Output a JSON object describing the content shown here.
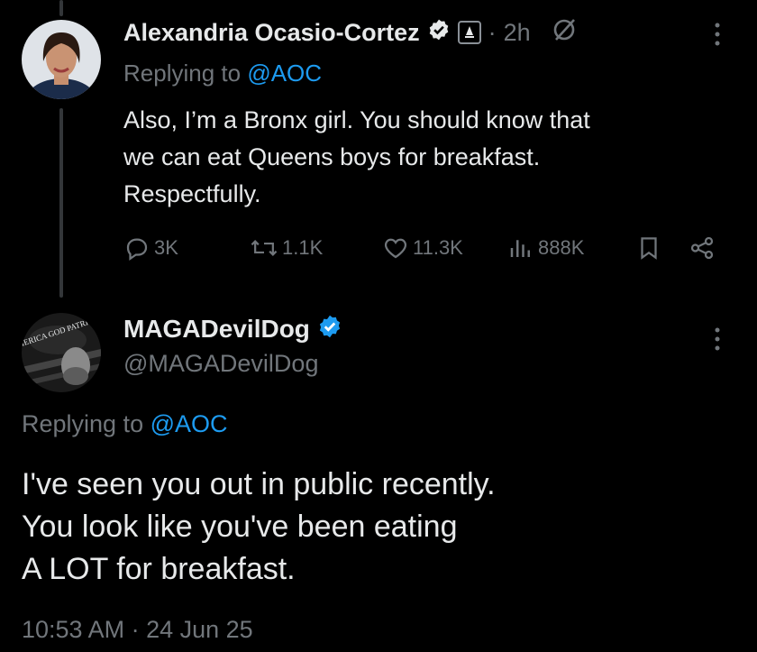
{
  "tweet1": {
    "author_name": "Alexandria Ocasio-Cortez",
    "time": "2h",
    "separator": "·",
    "replying_prefix": "Replying to",
    "replying_handle": "@AOC",
    "text_lines": [
      "Also, I’m a Bronx girl. You should know that",
      "we can eat Queens boys for breakfast.",
      "Respectfully."
    ],
    "actions": {
      "replies": "3K",
      "reposts": "1.1K",
      "likes": "11.3K",
      "views": "888K"
    }
  },
  "tweet2": {
    "author_name": "MAGADevilDog",
    "handle": "@MAGADevilDog",
    "avatar_text": "AMERICA GOD PATRIOTS",
    "replying_prefix": "Replying to",
    "replying_handle": "@AOC",
    "text_lines": [
      "I've seen you out in public recently.",
      "You look like you've been eating",
      "A LOT for breakfast."
    ],
    "timestamp": "10:53 AM · 24 Jun 25"
  },
  "colors": {
    "background": "#000000",
    "text": "#e7e9ea",
    "muted": "#71767b",
    "accent": "#1d9bf0"
  },
  "icons": {
    "verified": "verified-badge-icon",
    "gov": "government-capitol-icon",
    "grok": "grok-slash-icon",
    "more": "more-vertical-icon",
    "reply": "reply-icon",
    "repost": "repost-icon",
    "like": "heart-icon",
    "views": "views-bars-icon",
    "bookmark": "bookmark-icon",
    "share": "share-icon"
  }
}
